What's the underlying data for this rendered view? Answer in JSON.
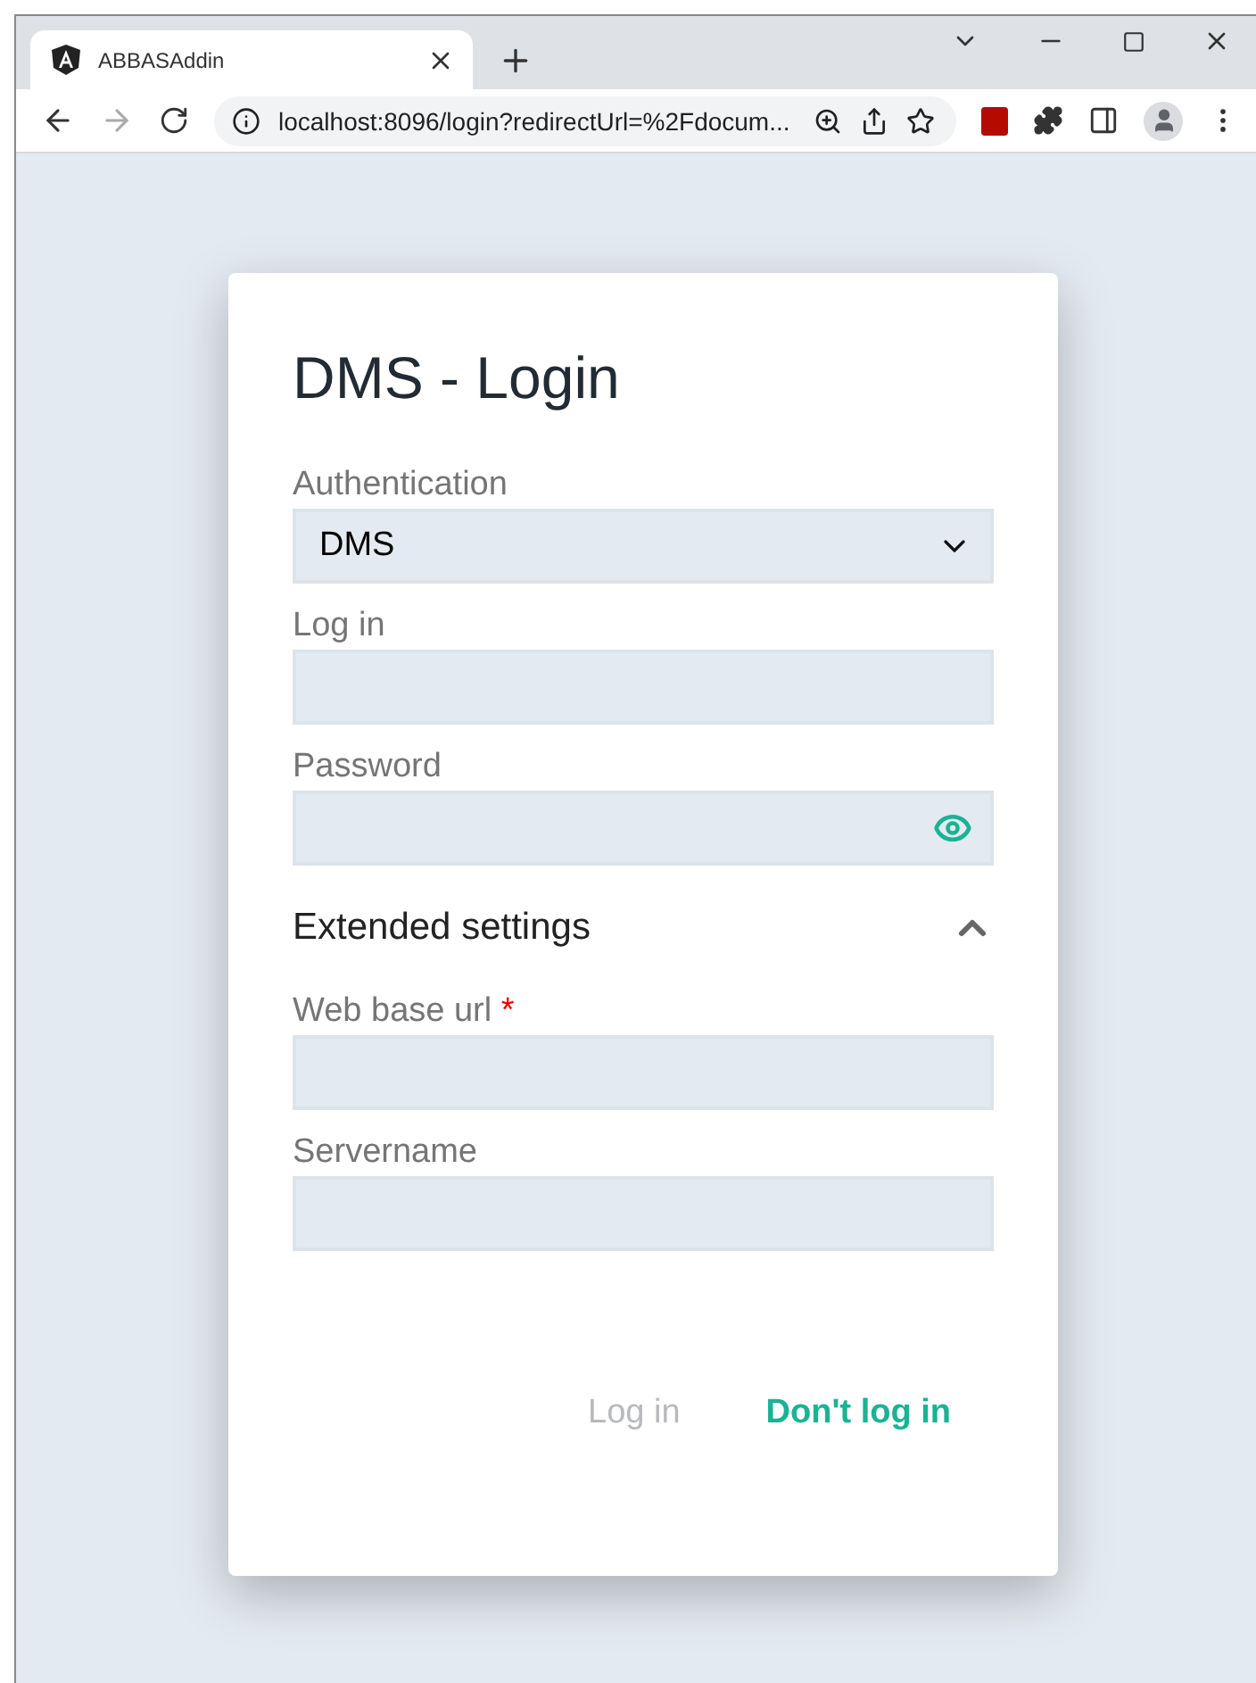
{
  "browser": {
    "tab_title": "ABBASAddin",
    "url": "localhost:8096/login?redirectUrl=%2Fdocum..."
  },
  "card": {
    "title": "DMS - Login",
    "fields": [
      {
        "kind": "select",
        "label": "Authentication",
        "value": "DMS"
      },
      {
        "kind": "text",
        "label": "Log in"
      },
      {
        "kind": "password",
        "label": "Password"
      }
    ],
    "extended": {
      "label": "Extended settings",
      "expanded": true,
      "fields": [
        {
          "kind": "text",
          "label": "Web base url",
          "required_mark": "*"
        },
        {
          "kind": "text",
          "label": "Servername"
        }
      ]
    },
    "buttons": [
      {
        "label": "Log in",
        "disabled": true
      },
      {
        "label": "Don't log in",
        "disabled": false
      }
    ]
  }
}
